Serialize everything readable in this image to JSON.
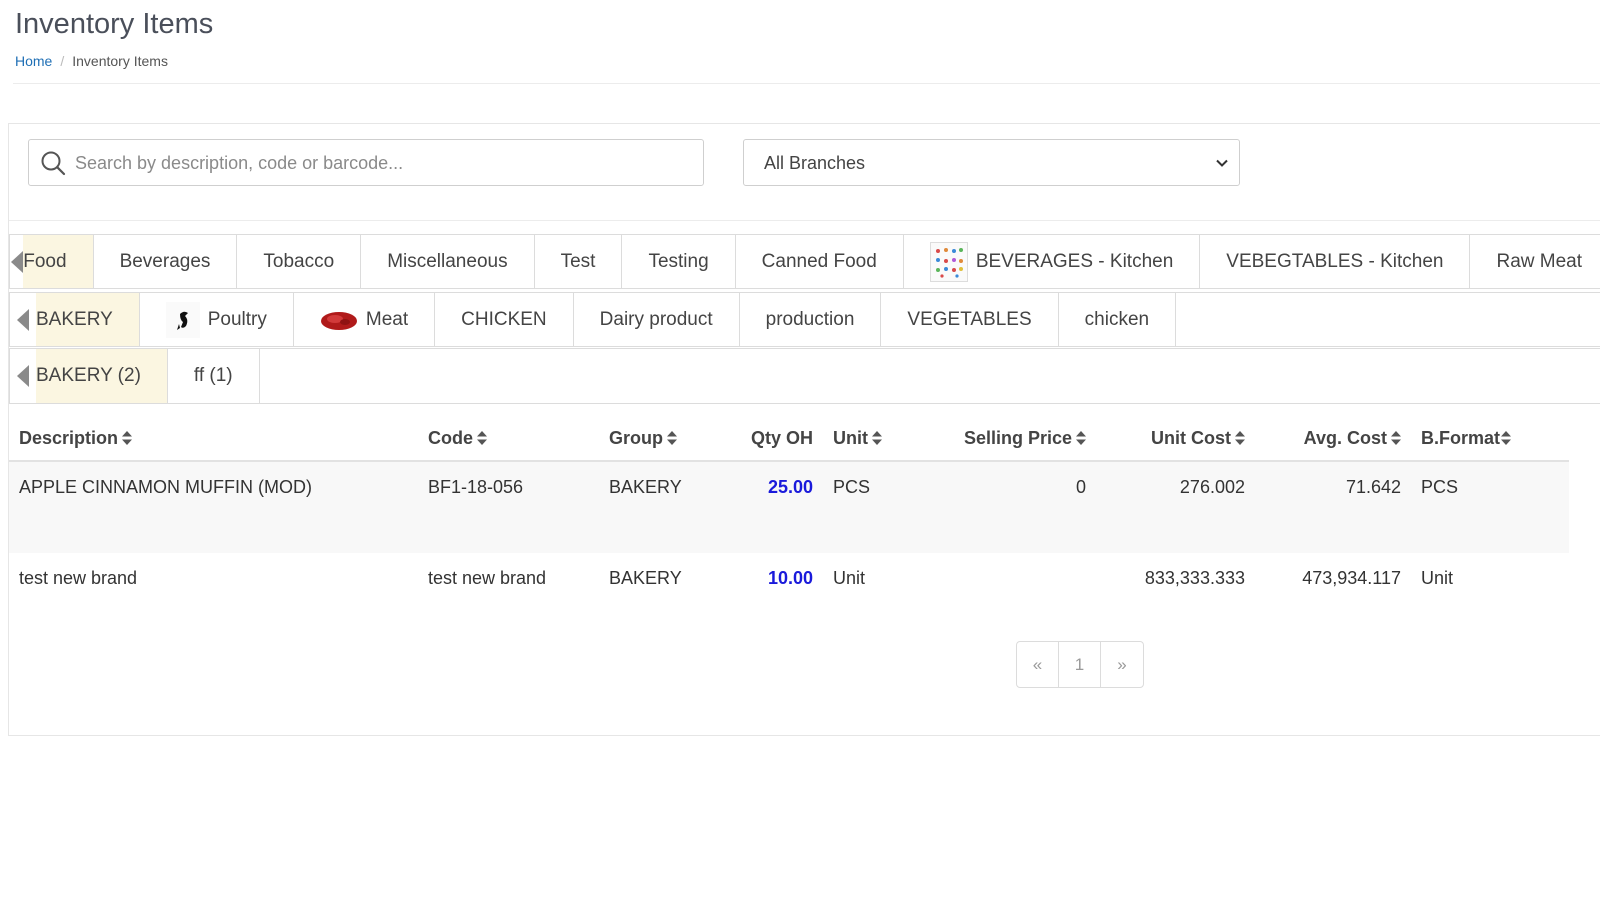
{
  "page": {
    "title": "Inventory Items",
    "breadcrumb": {
      "home": "Home",
      "current": "Inventory Items"
    }
  },
  "filters": {
    "search_placeholder": "Search by description, code or barcode...",
    "branch_selected": "All Branches"
  },
  "category_rows": [
    {
      "tabs": [
        {
          "label": "Food",
          "active": true
        },
        {
          "label": "Beverages"
        },
        {
          "label": "Tobacco"
        },
        {
          "label": "Miscellaneous"
        },
        {
          "label": "Test"
        },
        {
          "label": "Testing"
        },
        {
          "label": "Canned Food"
        },
        {
          "label": "BEVERAGES - Kitchen",
          "icon": "beverages-thumbnail-icon"
        },
        {
          "label": "VEBEGTABLES - Kitchen"
        },
        {
          "label": "Raw Meat"
        }
      ]
    },
    {
      "tabs": [
        {
          "label": "BAKERY",
          "active": true
        },
        {
          "label": "Poultry",
          "icon": "poultry-icon"
        },
        {
          "label": "Meat",
          "icon": "meat-icon"
        },
        {
          "label": "CHICKEN"
        },
        {
          "label": "Dairy product"
        },
        {
          "label": "production"
        },
        {
          "label": "VEGETABLES"
        },
        {
          "label": "chicken"
        }
      ]
    },
    {
      "tabs": [
        {
          "label": "BAKERY (2)",
          "active": true
        },
        {
          "label": "ff (1)"
        }
      ]
    }
  ],
  "table": {
    "columns": [
      "Description",
      "Code",
      "Group",
      "Qty OH",
      "Unit",
      "Selling Price",
      "Unit Cost",
      "Avg. Cost",
      "B.Format"
    ],
    "rows": [
      [
        "APPLE CINNAMON MUFFIN (MOD)",
        "BF1-18-056",
        "BAKERY",
        "25.00",
        "PCS",
        "0",
        "276.002",
        "71.642",
        "PCS"
      ],
      [
        "test new brand",
        "test new brand",
        "BAKERY",
        "10.00",
        "Unit",
        "",
        "833,333.333",
        "473,934.117",
        "Unit"
      ]
    ]
  },
  "pagination": {
    "prev": "«",
    "page": "1",
    "next": "»"
  },
  "colors": {
    "accent": "#1f6fb5",
    "qty": "#1a1adb",
    "active_tab": "#fbf6e1"
  }
}
